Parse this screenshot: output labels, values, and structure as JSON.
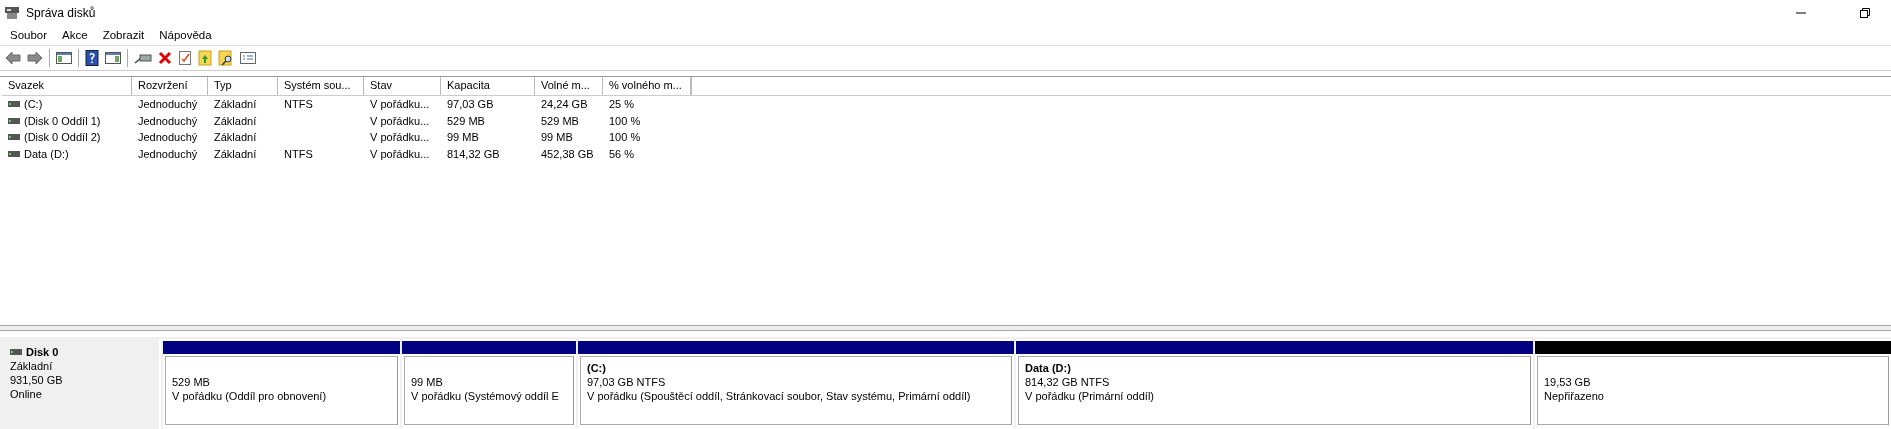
{
  "window": {
    "title": "Správa disků"
  },
  "menu": [
    "Soubor",
    "Akce",
    "Zobrazit",
    "Nápověda"
  ],
  "table": {
    "columns": [
      "Svazek",
      "Rozvržení",
      "Typ",
      "Systém sou...",
      "Stav",
      "Kapacita",
      "Volné m...",
      "% volného m..."
    ],
    "rows": [
      {
        "cells": [
          " (C:)",
          "Jednoduchý",
          "Základní",
          "NTFS",
          "V pořádku...",
          "97,03 GB",
          "24,24 GB",
          "25 %"
        ]
      },
      {
        "cells": [
          "(Disk 0 Oddíl 1)",
          "Jednoduchý",
          "Základní",
          "",
          "V pořádku...",
          "529 MB",
          "529 MB",
          "100 %"
        ]
      },
      {
        "cells": [
          "(Disk 0 Oddíl 2)",
          "Jednoduchý",
          "Základní",
          "",
          "V pořádku...",
          "99 MB",
          "99 MB",
          "100 %"
        ]
      },
      {
        "cells": [
          "Data (D:)",
          "Jednoduchý",
          "Základní",
          "NTFS",
          "V pořádku...",
          "814,32 GB",
          "452,38 GB",
          "56 %"
        ]
      }
    ]
  },
  "disk": {
    "name": "Disk 0",
    "type": "Základní",
    "size": "931,50 GB",
    "status": "Online",
    "partitions": [
      {
        "color": "#000080",
        "size": "529 MB",
        "status": "V pořádku (Oddíl pro obnovení)"
      },
      {
        "color": "#000080",
        "size": "99 MB",
        "status": "V pořádku (Systémový oddíl E"
      },
      {
        "color": "#000080",
        "name": "(C:)",
        "size": "97,03 GB NTFS",
        "status": "V pořádku (Spouštěcí oddíl, Stránkovací soubor, Stav systému, Primární oddíl)"
      },
      {
        "color": "#000080",
        "name": "Data  (D:)",
        "size": "814,32 GB NTFS",
        "status": "V pořádku (Primární oddíl)"
      },
      {
        "color": "#000000",
        "size": "19,53 GB",
        "status": "Nepřiřazeno"
      }
    ]
  }
}
